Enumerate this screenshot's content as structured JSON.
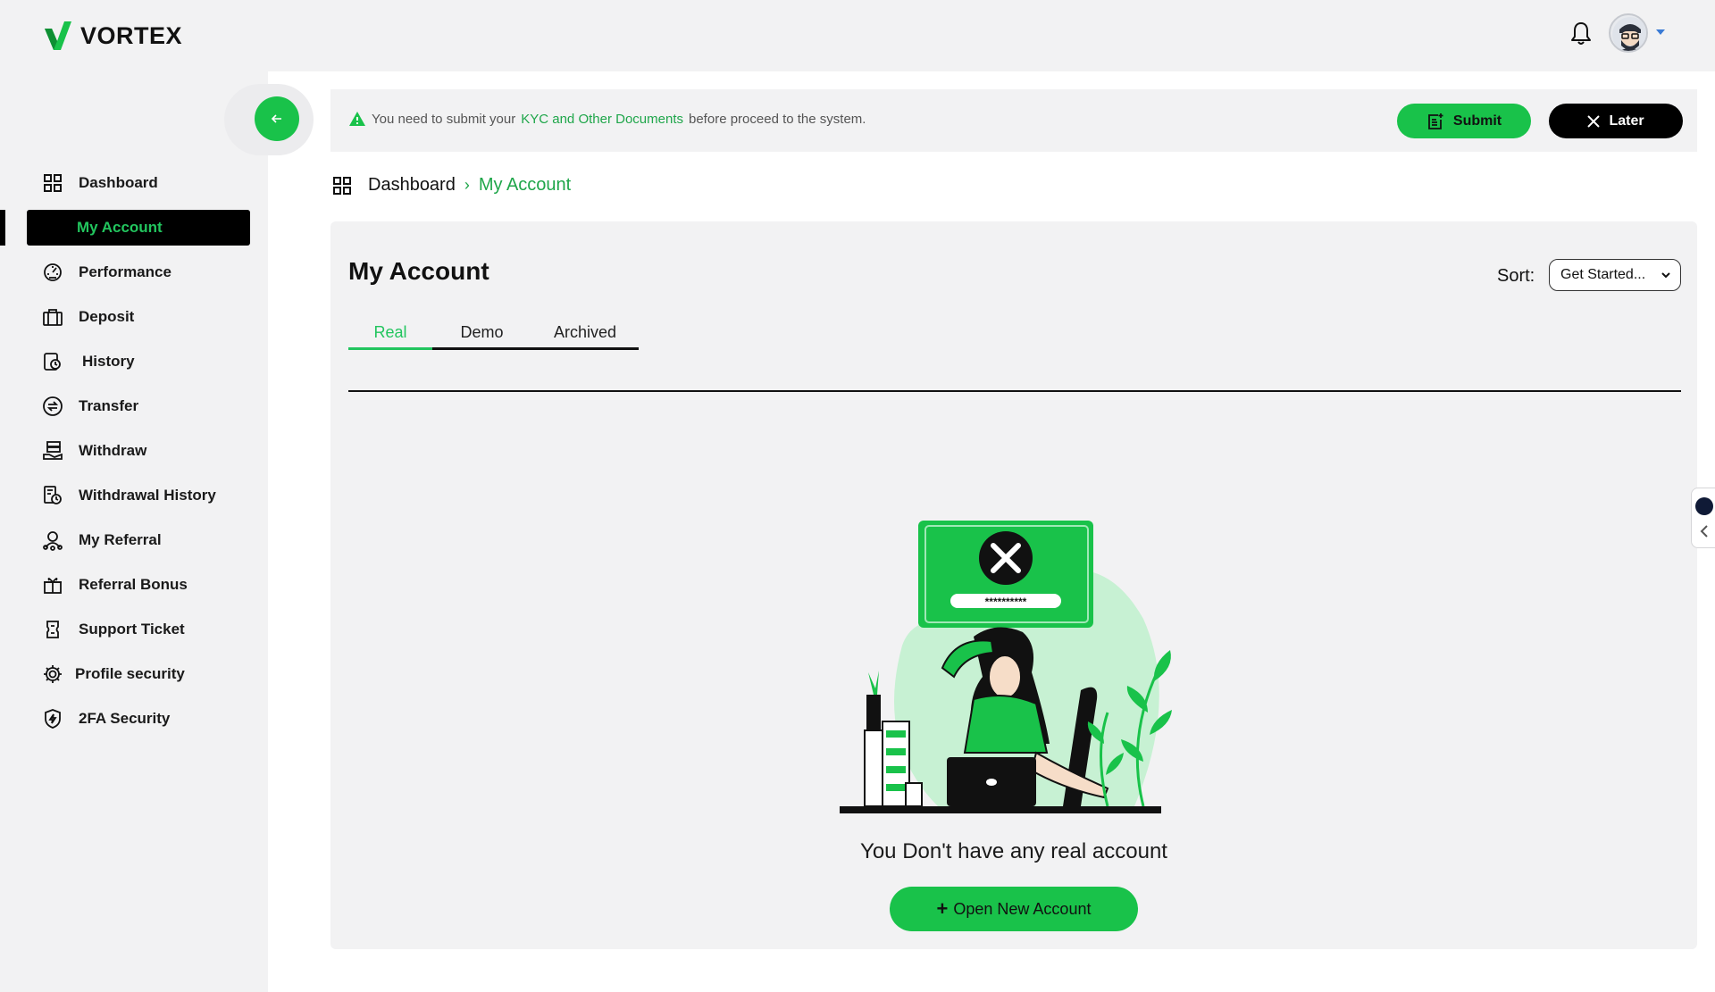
{
  "brand": {
    "name": "VORTEX",
    "accent": "#19c24a"
  },
  "header": {
    "bell_icon": "bell-icon",
    "avatar_icon": "user-avatar"
  },
  "sidebar": {
    "items": [
      {
        "label": "Dashboard",
        "icon": "grid-icon"
      },
      {
        "label": "My Account",
        "icon": "",
        "active": true
      },
      {
        "label": "Performance",
        "icon": "gauge-icon"
      },
      {
        "label": "Deposit",
        "icon": "briefcase-icon"
      },
      {
        "label": "History",
        "icon": "history-icon"
      },
      {
        "label": "Transfer",
        "icon": "transfer-icon"
      },
      {
        "label": "Withdraw",
        "icon": "withdraw-icon"
      },
      {
        "label": "Withdrawal History",
        "icon": "withdrawal-history-icon"
      },
      {
        "label": "My Referral",
        "icon": "referral-icon"
      },
      {
        "label": "Referral Bonus",
        "icon": "gift-icon"
      },
      {
        "label": "Support Ticket",
        "icon": "ticket-icon"
      },
      {
        "label": "Profile security",
        "icon": "gear-icon"
      },
      {
        "label": "2FA Security",
        "icon": "shield-icon"
      }
    ]
  },
  "kyc_banner": {
    "text_before": "You need to submit your",
    "link": "KYC and Other Documents",
    "text_after": "before proceed to the system.",
    "submit_label": "Submit",
    "later_label": "Later"
  },
  "breadcrumb": {
    "root": "Dashboard",
    "current": "My Account"
  },
  "main": {
    "title": "My Account",
    "sort_label": "Sort:",
    "sort_value": "Get Started...",
    "tabs": [
      {
        "label": "Real",
        "active": true
      },
      {
        "label": "Demo"
      },
      {
        "label": "Archived"
      }
    ],
    "empty_message": "You Don't have any real account",
    "open_button": "Open New Account",
    "illustration_password": "**********"
  }
}
